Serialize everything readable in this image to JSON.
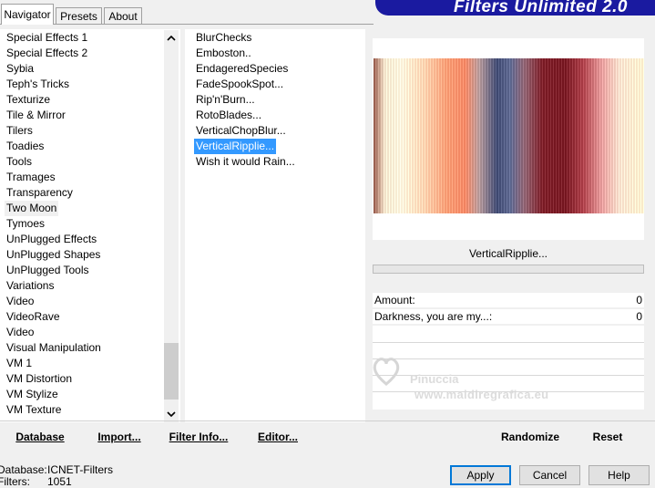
{
  "tabs": [
    {
      "label": "Navigator"
    },
    {
      "label": "Presets"
    },
    {
      "label": "About"
    }
  ],
  "banner_title": "Filters Unlimited 2.0",
  "categories": [
    "Special Effects 1",
    "Special Effects 2",
    "Sybia",
    "Teph's Tricks",
    "Texturize",
    "Tile & Mirror",
    "Tilers",
    "Toadies",
    "Tools",
    "Tramages",
    "Transparency",
    "Two Moon",
    "Tymoes",
    "UnPlugged Effects",
    "UnPlugged Shapes",
    "UnPlugged Tools",
    "Variations",
    "Video",
    "VideoRave",
    "Video",
    "Visual Manipulation",
    "VM 1",
    "VM Distortion",
    "VM Stylize",
    "VM Texture"
  ],
  "selected_category": "Two Moon",
  "filters": [
    "BlurChecks",
    "Emboston..",
    "EndageredSpecies",
    "FadeSpookSpot...",
    "Rip'n'Burn...",
    "RotoBlades...",
    "VerticalChopBlur...",
    "VerticalRipplie...",
    "Wish it would Rain..."
  ],
  "selected_filter": "VerticalRipplie...",
  "current_filter_name": "VerticalRipplie...",
  "params": [
    {
      "label": "Amount:",
      "value": "0"
    },
    {
      "label": "Darkness, you are my...:",
      "value": "0"
    }
  ],
  "toolbar": {
    "database": "Database",
    "import": "Import...",
    "filter_info": "Filter Info...",
    "editor": "Editor...",
    "randomize": "Randomize",
    "reset": "Reset"
  },
  "status": {
    "database_label": "Database:",
    "database_value": "ICNET-Filters",
    "filters_label": "Filters:",
    "filters_value": "1051"
  },
  "buttons": {
    "apply": "Apply",
    "cancel": "Cancel",
    "help": "Help"
  },
  "watermark": {
    "line1": "Pinuccia",
    "line2": "www.maldiregrafica.eu"
  },
  "colors": {
    "banner": "#1a1aa0",
    "selection": "#3399ff",
    "default_button_border": "#0078d7"
  },
  "icons": {
    "scroll_up": "chevron-up-icon",
    "scroll_down": "chevron-down-icon"
  }
}
